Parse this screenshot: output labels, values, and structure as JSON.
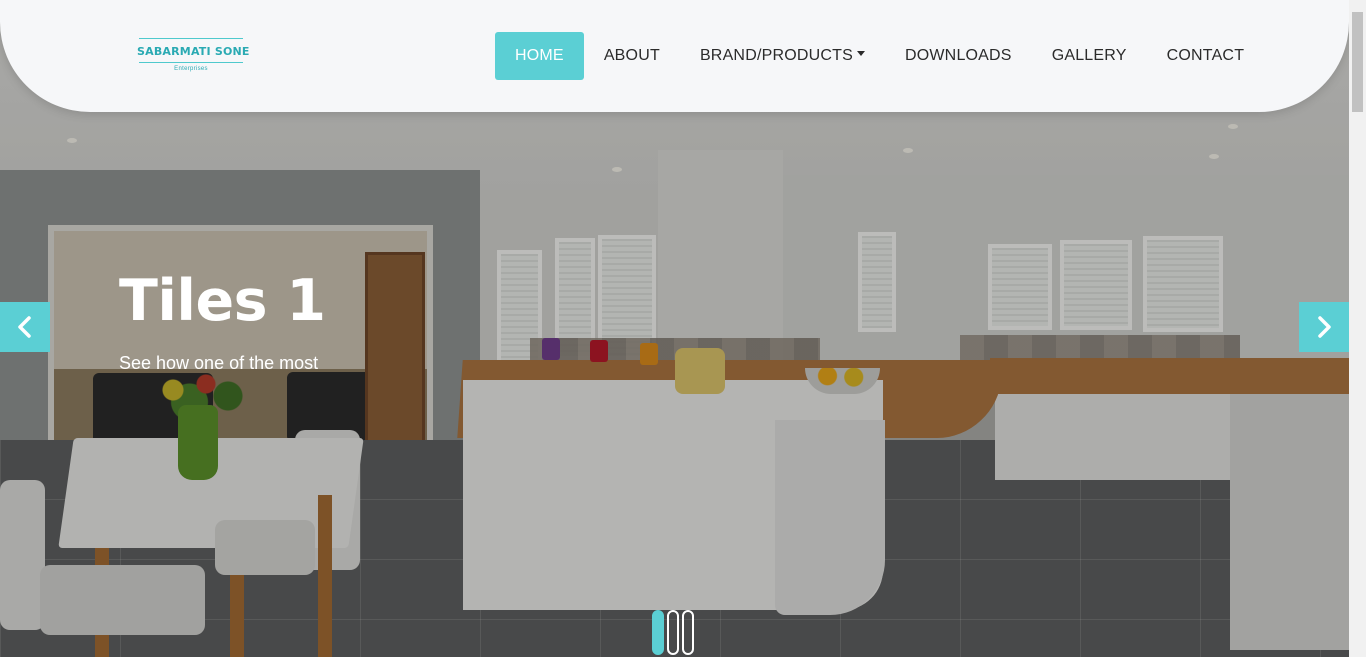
{
  "brand": {
    "name": "SABARMATI SONE",
    "tagline": "Enterprises",
    "accent_color": "#5bcfd4"
  },
  "nav": {
    "items": [
      {
        "label": "HOME",
        "active": true
      },
      {
        "label": "ABOUT",
        "active": false
      },
      {
        "label": "BRAND/PRODUCTS",
        "active": false,
        "has_dropdown": true
      },
      {
        "label": "DOWNLOADS",
        "active": false
      },
      {
        "label": "GALLERY",
        "active": false
      },
      {
        "label": "CONTACT",
        "active": false
      }
    ]
  },
  "hero": {
    "title": "Tiles 1",
    "description": "See how one of the most",
    "prev_icon": "chevron-left-icon",
    "next_icon": "chevron-right-icon",
    "slide_count": 3,
    "active_slide": 1
  }
}
